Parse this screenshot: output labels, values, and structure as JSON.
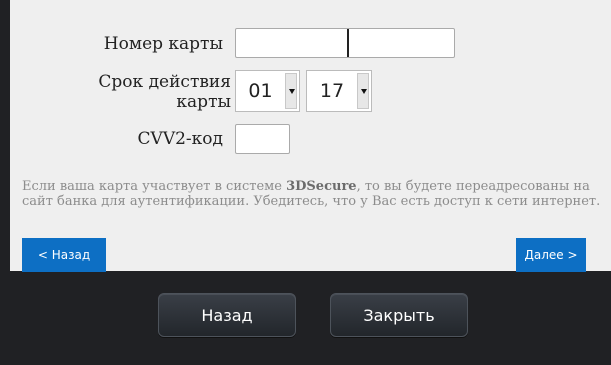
{
  "form": {
    "card_number_label": "Номер карты",
    "expiry_label_line1": "Срок действия",
    "expiry_label_line2": "карты",
    "expiry_month": "01",
    "expiry_year": "17",
    "cvv_label": "CVV2-код",
    "info_prefix": "Если ваша карта участвует в системе ",
    "info_bold": "3DSecure",
    "info_suffix": ", то вы будете переадресованы на сайт банка для аутентификации. Убедитесь, что у Вас есть доступ к сети интернет."
  },
  "nav": {
    "back_label": "< Назад",
    "next_label": "Далее >"
  },
  "dialog": {
    "back_label": "Назад",
    "close_label": "Закрыть"
  },
  "colors": {
    "accent": "#0d6fc4",
    "panel_bg": "#efefef",
    "dark_bg": "#202124"
  }
}
